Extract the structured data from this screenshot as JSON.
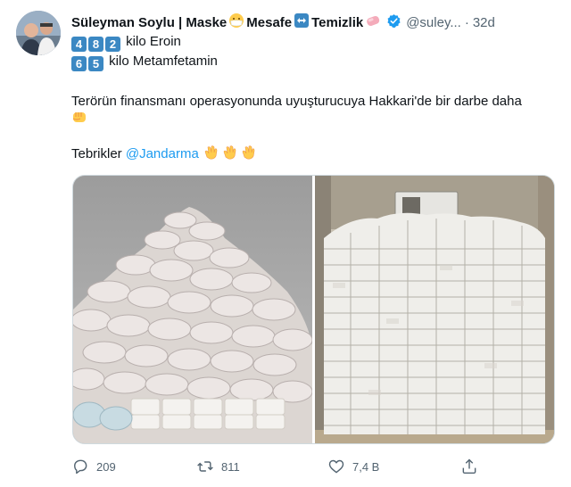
{
  "tweet": {
    "author_name": "Süleyman Soylu | Maske",
    "name_part_mesafe": "Mesafe",
    "name_part_temizlik": "Temizlik",
    "handle": "@suley...",
    "separator": "·",
    "time": "32d",
    "line1_digits": [
      "4",
      "8",
      "2"
    ],
    "line1_text": "kilo Eroin",
    "line2_digits": [
      "6",
      "5"
    ],
    "line2_text": "kilo Metamfetamin",
    "body": "Terörün finansmanı operasyonunda uyuşturucuya Hakkari'de bir darbe daha",
    "congrats": "Tebrikler",
    "mention": "@Jandarma"
  },
  "icons": {
    "name_emojis": [
      "mask-emoji",
      "left-right-arrow-emoji",
      "soap-emoji"
    ],
    "verified": "verified-badge-icon",
    "punch": "oncoming-fist-emoji",
    "clap": "clapping-hands-emoji"
  },
  "colors": {
    "link": "#1d9bf0",
    "secondary_text": "#536471",
    "keycap": "#3b88c3"
  },
  "actions": {
    "replies": "209",
    "retweets": "811",
    "likes": "7,4 B"
  }
}
